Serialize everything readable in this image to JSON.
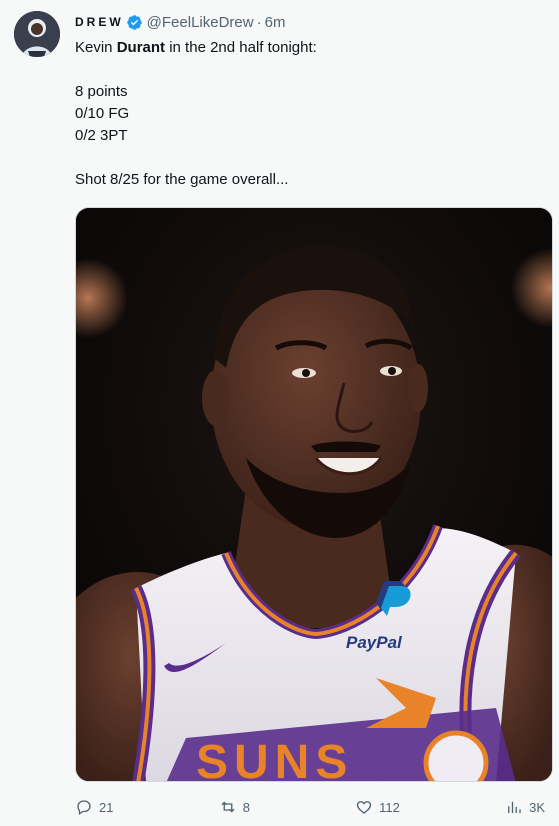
{
  "tweet": {
    "display_name": "DREW",
    "handle": "@FeelLikeDrew",
    "separator": "·",
    "time": "6m",
    "text": {
      "line1_before": "Kevin ",
      "line1_bold": "Durant",
      "line1_after": " in the 2nd half tonight:",
      "stat1": "8 points",
      "stat2": "0/10 FG",
      "stat3": "0/2 3PT",
      "summary": "Shot 8/25 for the game overall..."
    },
    "media": {
      "jersey_sponsor": "PayPal",
      "jersey_text": "SUNS"
    },
    "actions": {
      "replies": "21",
      "reposts": "8",
      "likes": "112",
      "views": "3K"
    },
    "icons": {
      "verified": "verified-badge-icon",
      "reply": "reply-icon",
      "repost": "repost-icon",
      "like": "heart-icon",
      "views": "views-icon"
    },
    "colors": {
      "verified": "#1d9bf0",
      "muted": "#536471",
      "text": "#0f1419",
      "jersey_purple": "#5a2d8c",
      "jersey_orange": "#e8832a"
    }
  }
}
